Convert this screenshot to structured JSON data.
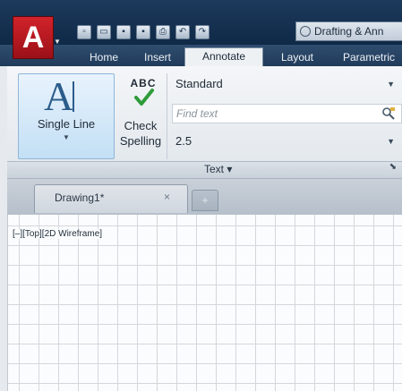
{
  "app": {
    "logo_letter": "A",
    "logo_color": "#c81e26",
    "workspace_label": "Drafting & Ann"
  },
  "quick_access": {
    "icons": [
      "new-icon",
      "open-icon",
      "save-icon",
      "save-as-icon",
      "plot-icon",
      "undo-icon",
      "redo-icon"
    ]
  },
  "ribbon_tabs": [
    {
      "label": "Home",
      "active": false
    },
    {
      "label": "Insert",
      "active": false
    },
    {
      "label": "Annotate",
      "active": true
    },
    {
      "label": "Layout",
      "active": false
    },
    {
      "label": "Parametric",
      "active": false
    }
  ],
  "text_panel": {
    "single_line_label": "Single Line",
    "abc_label": "ABC",
    "check_label_line1": "Check",
    "check_label_line2": "Spelling",
    "text_style": "Standard",
    "find_placeholder": "Find text",
    "text_height": "2.5",
    "panel_title": "Text ▾"
  },
  "document": {
    "tab_label": "Drawing1*",
    "close_glyph": "×",
    "new_tab_glyph": "+"
  },
  "viewport": {
    "label": "[–][Top][2D Wireframe]"
  }
}
